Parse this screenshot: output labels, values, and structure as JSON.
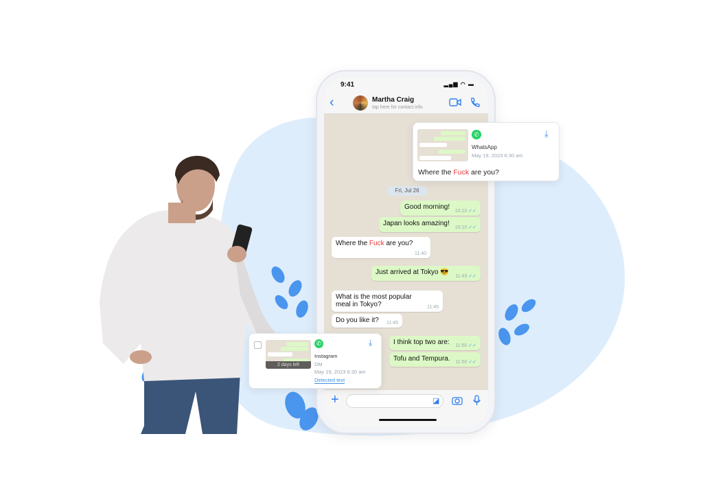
{
  "colors": {
    "accent": "#2f7ef0",
    "blob": "#deedfc",
    "leaf": "#4a95ee",
    "outgoing": "#dcf8c6",
    "profanity": "#e53935",
    "whatsapp": "#25d366"
  },
  "phone": {
    "status_time": "9:41",
    "contact_name": "Martha Craig",
    "contact_sub": "tap here for contact info",
    "date_chip": "Fri, Jul 26",
    "messages": [
      {
        "dir": "out",
        "text": "Good morning!",
        "time": "10:10"
      },
      {
        "dir": "out",
        "text": "Japan looks amazing!",
        "time": "10:10"
      },
      {
        "dir": "in",
        "pre": "Where the ",
        "flag": "Fuck",
        "post": " are you?",
        "time": "11:40"
      },
      {
        "dir": "out",
        "text": "Just arrived at Tokyo 😎",
        "time": "11:43"
      },
      {
        "dir": "in",
        "text": "What is the most popular meal in Tokyo?",
        "time": "11:45"
      },
      {
        "dir": "in",
        "text": "Do you like it?",
        "time": "11:45"
      },
      {
        "dir": "out",
        "text": "I think top two are:",
        "time": "11:50"
      },
      {
        "dir": "out",
        "text": "Tofu and Tempura.",
        "time": "11:50"
      }
    ]
  },
  "card_whatsapp": {
    "app": "WhatsApp",
    "date": "May 19, 2023 6:30 am",
    "pre": "Where the ",
    "flag": "Fuck",
    "post": " are you?"
  },
  "card_instagram": {
    "app": "Instagram",
    "type": "DM",
    "date": "May 19, 2023 6:30 am",
    "badge": "2 days left",
    "link": "Detected text"
  }
}
